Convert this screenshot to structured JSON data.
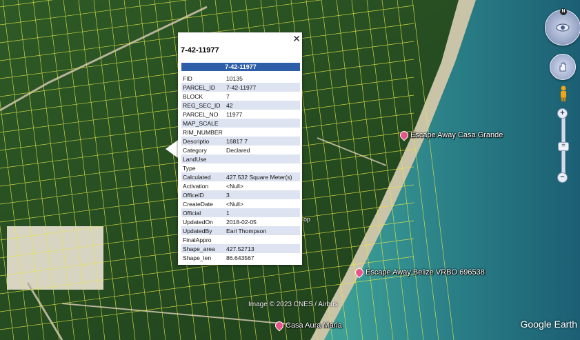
{
  "popup": {
    "title": "7-42-11977",
    "header": "7-42-11977",
    "rows": [
      {
        "k": "FID",
        "v": "10135"
      },
      {
        "k": "PARCEL_ID",
        "v": "7-42-11977"
      },
      {
        "k": "BLOCK",
        "v": "7"
      },
      {
        "k": "REG_SEC_ID",
        "v": "42"
      },
      {
        "k": "PARCEL_NO",
        "v": "11977"
      },
      {
        "k": "MAP_SCALE",
        "v": ""
      },
      {
        "k": "RIM_NUMBER",
        "v": ""
      },
      {
        "k": "Descriptio",
        "v": "16817 7"
      },
      {
        "k": "Category",
        "v": "Declared"
      },
      {
        "k": "LandUse",
        "v": ""
      },
      {
        "k": "Type",
        "v": ""
      },
      {
        "k": "Calculated",
        "v": "427.532 Square Meter(s)"
      },
      {
        "k": "Activation",
        "v": "<Null>"
      },
      {
        "k": "OfficeID",
        "v": "3"
      },
      {
        "k": "CreateDate",
        "v": "<Null>"
      },
      {
        "k": "Official",
        "v": "1"
      },
      {
        "k": "UpdatedOn",
        "v": "2018-02-05"
      },
      {
        "k": "UpdatedBy",
        "v": "Earl Thompson"
      },
      {
        "k": "FinalAppro",
        "v": ""
      },
      {
        "k": "Shape_area",
        "v": "427.52713"
      },
      {
        "k": "Shape_len",
        "v": "86.643567"
      }
    ],
    "close_glyph": "✕"
  },
  "places": {
    "casa_grande": "Escape Away Casa Grande",
    "vrbo": "Escape Away Belize VRBO 696538",
    "aura": "Casa Aura Maria",
    "shop_fragment": "op"
  },
  "credit": "Image © 2023 CNES / Airbus",
  "brand": "Google Earth",
  "nav": {
    "north": "N",
    "zoom_in": "+",
    "zoom_out": "−",
    "slider": "="
  },
  "colors": {
    "parcel_line": "#e8e84a",
    "popup_header": "#2f5ea8",
    "pin": "#e8538a"
  }
}
